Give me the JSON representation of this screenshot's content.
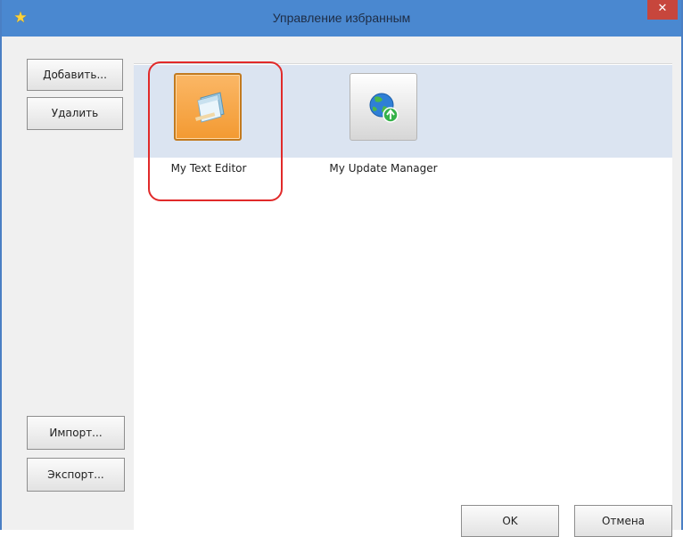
{
  "window": {
    "title": "Управление избранным",
    "title_icon": "star-icon",
    "close_icon": "close-icon"
  },
  "sidebar": {
    "add_label": "Добавить...",
    "delete_label": "Удалить",
    "import_label": "Импорт...",
    "export_label": "Экспорт..."
  },
  "favorites": [
    {
      "label": "My Text Editor",
      "icon": "notepad-icon",
      "selected": true
    },
    {
      "label": "My Update Manager",
      "icon": "globe-update-icon",
      "selected": false
    }
  ],
  "footer": {
    "ok_label": "OK",
    "cancel_label": "Отмена"
  },
  "colors": {
    "titlebar": "#4a88d0",
    "selected_tile": "#f39a32",
    "selection_band": "#dbe4f1",
    "annotation": "#e12a2a"
  }
}
